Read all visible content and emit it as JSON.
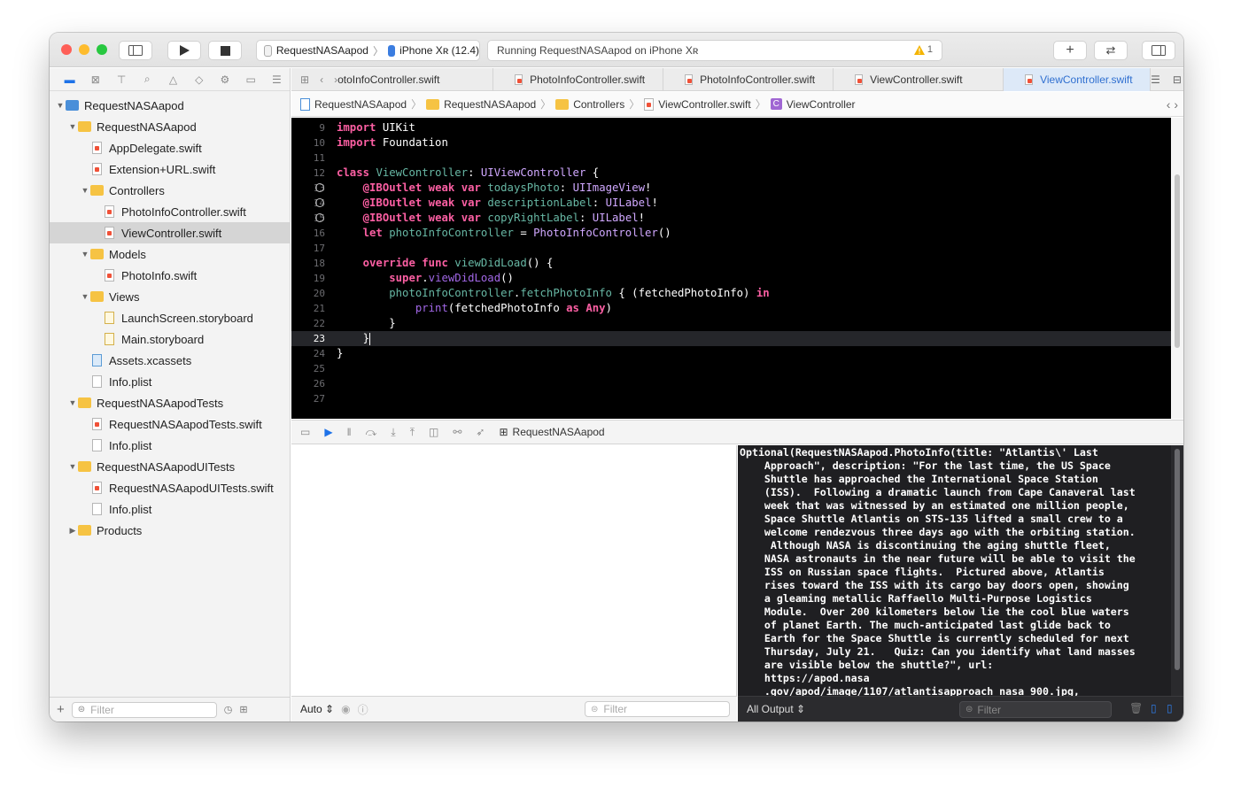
{
  "toolbar": {
    "scheme": "RequestNASAapod",
    "device": "iPhone Xʀ (12.4)",
    "status": "Running RequestNASAapod on iPhone Xʀ",
    "warning_count": "1",
    "colors": {
      "close": "#fe5f57",
      "minimize": "#febc2e",
      "zoom": "#28c840"
    }
  },
  "navigator": {
    "items": [
      {
        "label": "RequestNASAapod",
        "kind": "project",
        "indent": 0,
        "tri": "▼"
      },
      {
        "label": "RequestNASAapod",
        "kind": "folder",
        "indent": 1,
        "tri": "▼"
      },
      {
        "label": "AppDelegate.swift",
        "kind": "swift",
        "indent": 2,
        "tri": ""
      },
      {
        "label": "Extension+URL.swift",
        "kind": "swift",
        "indent": 2,
        "tri": ""
      },
      {
        "label": "Controllers",
        "kind": "folder",
        "indent": 2,
        "tri": "▼"
      },
      {
        "label": "PhotoInfoController.swift",
        "kind": "swift",
        "indent": 3,
        "tri": ""
      },
      {
        "label": "ViewController.swift",
        "kind": "swift",
        "indent": 3,
        "tri": "",
        "selected": true
      },
      {
        "label": "Models",
        "kind": "folder",
        "indent": 2,
        "tri": "▼"
      },
      {
        "label": "PhotoInfo.swift",
        "kind": "swift",
        "indent": 3,
        "tri": ""
      },
      {
        "label": "Views",
        "kind": "folder",
        "indent": 2,
        "tri": "▼"
      },
      {
        "label": "LaunchScreen.storyboard",
        "kind": "storyboard",
        "indent": 3,
        "tri": ""
      },
      {
        "label": "Main.storyboard",
        "kind": "storyboard",
        "indent": 3,
        "tri": ""
      },
      {
        "label": "Assets.xcassets",
        "kind": "assets",
        "indent": 2,
        "tri": ""
      },
      {
        "label": "Info.plist",
        "kind": "plist",
        "indent": 2,
        "tri": ""
      },
      {
        "label": "RequestNASAapodTests",
        "kind": "folder",
        "indent": 1,
        "tri": "▼"
      },
      {
        "label": "RequestNASAapodTests.swift",
        "kind": "swift",
        "indent": 2,
        "tri": ""
      },
      {
        "label": "Info.plist",
        "kind": "plist",
        "indent": 2,
        "tri": ""
      },
      {
        "label": "RequestNASAapodUITests",
        "kind": "folder",
        "indent": 1,
        "tri": "▼"
      },
      {
        "label": "RequestNASAapodUITests.swift",
        "kind": "swift",
        "indent": 2,
        "tri": ""
      },
      {
        "label": "Info.plist",
        "kind": "plist",
        "indent": 2,
        "tri": ""
      },
      {
        "label": "Products",
        "kind": "folder",
        "indent": 1,
        "tri": "▶"
      }
    ],
    "filter_placeholder": "Filter"
  },
  "tabs": [
    {
      "label": "otoInfoController.swift",
      "active": false
    },
    {
      "label": "PhotoInfoController.swift",
      "active": false
    },
    {
      "label": "PhotoInfoController.swift",
      "active": false
    },
    {
      "label": "ViewController.swift",
      "active": false
    },
    {
      "label": "ViewController.swift",
      "active": true
    }
  ],
  "jumpbar": [
    "RequestNASAapod",
    "RequestNASAapod",
    "Controllers",
    "ViewController.swift",
    "ViewController"
  ],
  "editor": {
    "lines": [
      {
        "n": "9",
        "html": "<span class=\"kw\">import</span> UIKit"
      },
      {
        "n": "10",
        "html": "<span class=\"kw\">import</span> Foundation"
      },
      {
        "n": "11",
        "html": ""
      },
      {
        "n": "12",
        "html": "<span class=\"kw\">class</span> <span class=\"pr\">ViewController</span>: <span class=\"ty\">UIViewController</span> {"
      },
      {
        "n": "13",
        "html": "    <span class=\"kw\">@IBOutlet</span> <span class=\"kw\">weak</span> <span class=\"kw\">var</span> <span class=\"pr\">todaysPhoto</span>: <span class=\"ty\">UIImageView</span>!",
        "outlet": true
      },
      {
        "n": "14",
        "html": "    <span class=\"kw\">@IBOutlet</span> <span class=\"kw\">weak</span> <span class=\"kw\">var</span> <span class=\"pr\">descriptionLabel</span>: <span class=\"ty\">UILabel</span>!",
        "outlet": true
      },
      {
        "n": "15",
        "html": "    <span class=\"kw\">@IBOutlet</span> <span class=\"kw\">weak</span> <span class=\"kw\">var</span> <span class=\"pr\">copyRightLabel</span>: <span class=\"ty\">UILabel</span>!",
        "outlet": true
      },
      {
        "n": "16",
        "html": "    <span class=\"kw\">let</span> <span class=\"pr\">photoInfoController</span> = <span class=\"ty\">PhotoInfoController</span>()"
      },
      {
        "n": "17",
        "html": ""
      },
      {
        "n": "18",
        "html": "    <span class=\"kw\">override</span> <span class=\"kw\">func</span> <span class=\"pr\">viewDidLoad</span>() {"
      },
      {
        "n": "19",
        "html": "        <span class=\"kw\">super</span>.<span class=\"fn\">viewDidLoad</span>()"
      },
      {
        "n": "20",
        "html": "        <span class=\"pr\">photoInfoController</span>.<span class=\"pr\">fetchPhotoInfo</span> { (fetchedPhotoInfo) <span class=\"kw\">in</span>"
      },
      {
        "n": "21",
        "html": "            <span class=\"fn\">print</span>(fetchedPhotoInfo <span class=\"kw\">as</span> <span class=\"kw\">Any</span>)"
      },
      {
        "n": "22",
        "html": "        }"
      },
      {
        "n": "23",
        "html": "    }<span class=\"cursor\"></span>",
        "current": true
      },
      {
        "n": "24",
        "html": "}"
      },
      {
        "n": "25",
        "html": ""
      },
      {
        "n": "26",
        "html": ""
      },
      {
        "n": "27",
        "html": ""
      }
    ]
  },
  "debugbar": {
    "target": "RequestNASAapod"
  },
  "console": {
    "lines": [
      "Optional(RequestNASAapod.PhotoInfo(title: \"Atlantis\\' Last",
      "    Approach\", description: \"For the last time, the US Space",
      "    Shuttle has approached the International Space Station",
      "    (ISS).  Following a dramatic launch from Cape Canaveral last",
      "    week that was witnessed by an estimated one million people,",
      "    Space Shuttle Atlantis on STS-135 lifted a small crew to a",
      "    welcome rendezvous three days ago with the orbiting station.",
      "     Although NASA is discontinuing the aging shuttle fleet,",
      "    NASA astronauts in the near future will be able to visit the",
      "    ISS on Russian space flights.  Pictured above, Atlantis",
      "    rises toward the ISS with its cargo bay doors open, showing",
      "    a gleaming metallic Raffaello Multi-Purpose Logistics",
      "    Module.  Over 200 kilometers below lie the cool blue waters",
      "    of planet Earth. The much-anticipated last glide back to",
      "    Earth for the Space Shuttle is currently scheduled for next",
      "    Thursday, July 21.   Quiz: Can you identify what land masses",
      "    are visible below the shuttle?\", url:",
      "    https://apod.nasa",
      "    .gov/apod/image/1107/atlantisapproach_nasa_900.jpg,"
    ],
    "output_select": "All Output",
    "filter_placeholder": "Filter"
  },
  "variables": {
    "scope_select": "Auto",
    "filter_placeholder": "Filter"
  }
}
